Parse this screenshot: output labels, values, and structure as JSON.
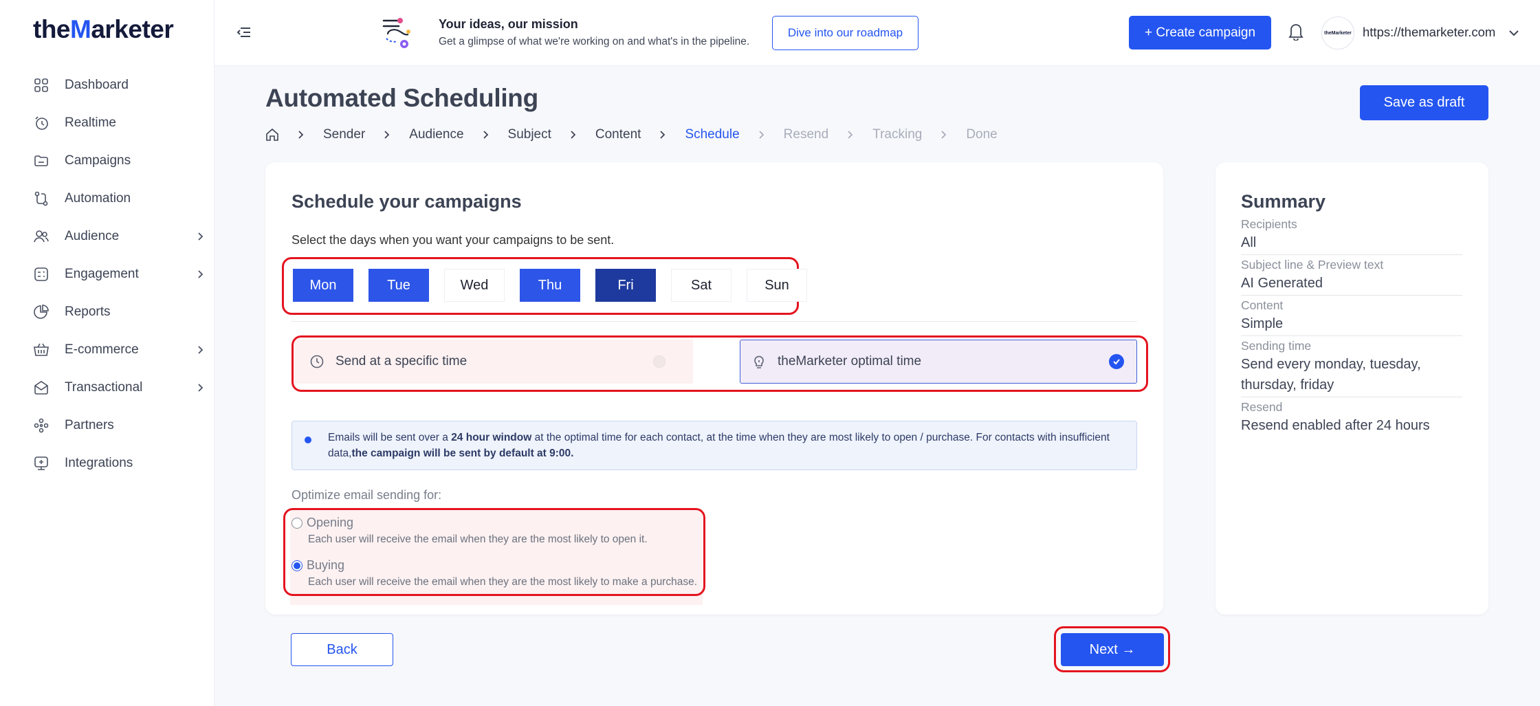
{
  "brand": {
    "prefix": "the",
    "mark": "M",
    "suffix": "arketer"
  },
  "nav": [
    {
      "label": "Dashboard",
      "icon": "dashboard-icon",
      "chevron": false
    },
    {
      "label": "Realtime",
      "icon": "realtime-icon",
      "chevron": false
    },
    {
      "label": "Campaigns",
      "icon": "folder-icon",
      "chevron": false
    },
    {
      "label": "Automation",
      "icon": "automation-icon",
      "chevron": false
    },
    {
      "label": "Audience",
      "icon": "users-icon",
      "chevron": true
    },
    {
      "label": "Engagement",
      "icon": "engagement-icon",
      "chevron": true
    },
    {
      "label": "Reports",
      "icon": "pie-chart-icon",
      "chevron": false
    },
    {
      "label": "E-commerce",
      "icon": "basket-icon",
      "chevron": true
    },
    {
      "label": "Transactional",
      "icon": "envelope-icon",
      "chevron": true
    },
    {
      "label": "Partners",
      "icon": "partners-icon",
      "chevron": false
    },
    {
      "label": "Integrations",
      "icon": "integrations-icon",
      "chevron": false
    }
  ],
  "topbar": {
    "roadmap_title": "Your ideas, our mission",
    "roadmap_subtitle": "Get a glimpse of what we're working on and what's in the pipeline.",
    "roadmap_button": "Dive into our roadmap",
    "create_button": "+ Create campaign",
    "avatar_text": "theMarketer",
    "site": "https://themarketer.com"
  },
  "page": {
    "title": "Automated Scheduling",
    "draft_button": "Save as draft"
  },
  "breadcrumb": [
    {
      "label": "Sender",
      "state": "done"
    },
    {
      "label": "Audience",
      "state": "done"
    },
    {
      "label": "Subject",
      "state": "done"
    },
    {
      "label": "Content",
      "state": "done"
    },
    {
      "label": "Schedule",
      "state": "active"
    },
    {
      "label": "Resend",
      "state": "future"
    },
    {
      "label": "Tracking",
      "state": "future"
    },
    {
      "label": "Done",
      "state": "future"
    }
  ],
  "schedule": {
    "title": "Schedule your campaigns",
    "hint": "Select the days when you want your campaigns to be sent.",
    "days": [
      {
        "label": "Mon",
        "selected": true
      },
      {
        "label": "Tue",
        "selected": true
      },
      {
        "label": "Wed",
        "selected": false
      },
      {
        "label": "Thu",
        "selected": true
      },
      {
        "label": "Fri",
        "selected": true
      },
      {
        "label": "Sat",
        "selected": false
      },
      {
        "label": "Sun",
        "selected": false
      }
    ],
    "option_specific": "Send at a specific time",
    "option_optimal": "theMarketer optimal time",
    "info_part1": "Emails will be sent over a ",
    "info_bold1": "24 hour window",
    "info_part2": " at the optimal time for each contact, at the time when they are most likely to open / purchase. For contacts with insufficient data,",
    "info_bold2": "the campaign will be sent by default at 9:00.",
    "optimize_label": "Optimize email sending for:",
    "goal_opening": "Opening",
    "goal_opening_desc": "Each user will receive the email when they are the most likely to open it.",
    "goal_buying": "Buying",
    "goal_buying_desc": "Each user will receive the email when they are the most likely to make a purchase.",
    "back_button": "Back",
    "next_button": "Next →"
  },
  "summary": {
    "title": "Summary",
    "rows": [
      {
        "label": "Recipients",
        "value": "All"
      },
      {
        "label": "Subject line & Preview text",
        "value": "AI Generated"
      },
      {
        "label": "Content",
        "value": "Simple"
      },
      {
        "label": "Sending time",
        "value": "Send every monday, tuesday, thursday, friday"
      },
      {
        "label": "Resend",
        "value": "Resend enabled after 24 hours"
      }
    ]
  },
  "colors": {
    "accent": "#2455f0",
    "highlight": "#e4141f"
  }
}
